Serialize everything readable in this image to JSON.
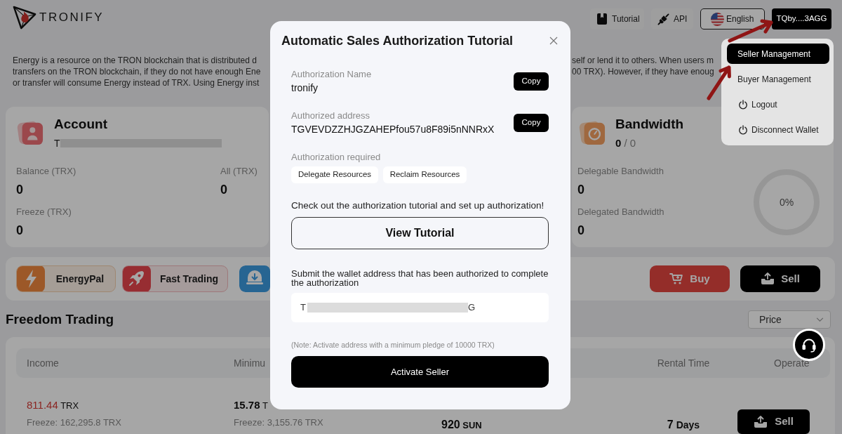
{
  "header": {
    "logo_text": "TRONIFY",
    "nav": [
      {
        "kind": "tutorial",
        "label": "Tutorial"
      },
      {
        "kind": "api",
        "label": "API"
      },
      {
        "kind": "language",
        "label": "English"
      }
    ],
    "wallet": "TQby....3AGG"
  },
  "intro": {
    "left_lines": [
      "Energy is a resource on the TRON blockchain that is distributed d",
      "transfers on the TRON blockchain, if they do not have enough Ene",
      "or transfer will consume Energy instead of TRX. Using Energy inst"
    ],
    "right_lines": [
      "self or lend it to others. When users m",
      "00 TRX). However, if they have enoug"
    ]
  },
  "account_card": {
    "title": "Account",
    "address_start": "T",
    "stats": [
      {
        "label": "Balance (TRX)",
        "value": "0"
      },
      {
        "label": "All (TRX)",
        "value": "0"
      },
      {
        "label": "Freeze (TRX)",
        "value": "0"
      }
    ]
  },
  "bandwidth_card": {
    "title": "Bandwidth",
    "used": "0",
    "total": "/ 0",
    "stats": [
      {
        "label": "Delegable Bandwidth",
        "value": "0"
      },
      {
        "label": "Delegated Bandwidth",
        "value": "0"
      }
    ],
    "gauge": {
      "level": 0,
      "reading": "0%"
    }
  },
  "quick_actions": [
    {
      "kind": "energy",
      "label": "EnergyPal"
    },
    {
      "kind": "rocket",
      "label": "Fast Trading"
    },
    {
      "kind": "download"
    }
  ],
  "trade_buttons": [
    {
      "kind": "buy",
      "label": "Buy"
    },
    {
      "kind": "sell",
      "label": "Sell"
    }
  ],
  "freedom_trading": {
    "title": "Freedom Trading",
    "sort": "Price",
    "columns": [
      {
        "kind": "income",
        "label": "Income"
      },
      {
        "kind": "minimum",
        "label": "Minimu"
      },
      {
        "kind": "rental_time",
        "label": "Rental Time"
      },
      {
        "kind": "operate",
        "label": "Operate"
      }
    ],
    "rows": [
      {
        "income": {
          "value": "811.44",
          "unit": "TRX",
          "freeze": "Freeze: 162,295.8 TRX"
        },
        "minimum": {
          "value": "15.78",
          "unit": "T",
          "freeze": "Freeze: 3,155.76 TRX"
        },
        "price": {
          "value": "920",
          "unit": "SUN"
        },
        "rental_time": {
          "value": "7",
          "unit": "Days"
        },
        "action": "Sell"
      }
    ]
  },
  "modal": {
    "title": "Automatic Sales Authorization Tutorial",
    "fields": [
      {
        "label": "Authorization Name",
        "value": "tronify",
        "button": "Copy"
      },
      {
        "label": "Authorized address",
        "value": "TGVEVDZZHJGZAHEPfou57u8F89i5nNNRxX",
        "button": "Copy"
      }
    ],
    "required_label": "Authorization required",
    "permissions": [
      "Delegate Resources",
      "Reclaim Resources"
    ],
    "tutorial_prompt": "Check out the authorization tutorial and set up authorization!",
    "tutorial_button": "View Tutorial",
    "submit_prompt": "Submit the wallet address that has been authorized to complete the authorization",
    "wallet_input": {
      "value_start": "T",
      "value_end": "G"
    },
    "note": "(Note: Activate address with a minimum pledge of 10000 TRX)",
    "activate_button": "Activate Seller"
  },
  "account_menu": [
    {
      "kind": "plain",
      "label": "Seller Management",
      "selected": true
    },
    {
      "kind": "plain",
      "label": "Buyer Management",
      "selected": false
    },
    {
      "kind": "power",
      "label": "Logout",
      "selected": false
    },
    {
      "kind": "power",
      "label": "Disconnect Wallet",
      "selected": false
    }
  ]
}
